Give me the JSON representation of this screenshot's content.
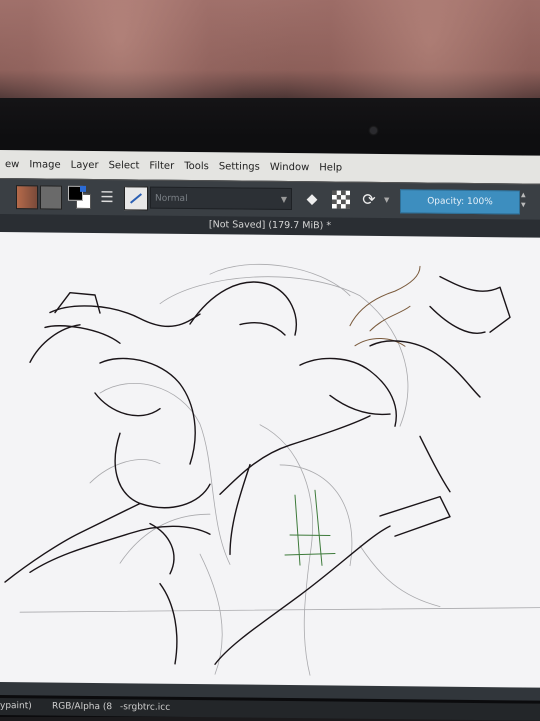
{
  "menu": {
    "items": [
      {
        "label": "ew",
        "u": ""
      },
      {
        "label": "Image",
        "u": ""
      },
      {
        "label": "Layer",
        "u": ""
      },
      {
        "label": "Select",
        "u": ""
      },
      {
        "label": "Filter",
        "u": ""
      },
      {
        "label": "Tools",
        "u": ""
      },
      {
        "label": "Settings",
        "u": ""
      },
      {
        "label": "Window",
        "u": ""
      },
      {
        "label": "Help",
        "u": ""
      }
    ]
  },
  "toolbar": {
    "blend_mode": "Normal",
    "opacity_label": "Opacity: 100%",
    "icons": [
      "gradient-swatch",
      "pattern-swatch",
      "fg-bg-color",
      "brush-presets",
      "brush-preview",
      "eraser",
      "alpha-lock",
      "reload-preset"
    ]
  },
  "document": {
    "title": "[Not Saved]  (179.7 MiB) *"
  },
  "status": {
    "left": "ypaint)",
    "color_space": "RGB/Alpha (8",
    "profile": "-srgbtrc.icc"
  },
  "colors": {
    "accent": "#3d8ebf",
    "toolbar": "#3a3f44",
    "menubar": "#e4e4e1",
    "canvas": "#f4f4f6"
  }
}
